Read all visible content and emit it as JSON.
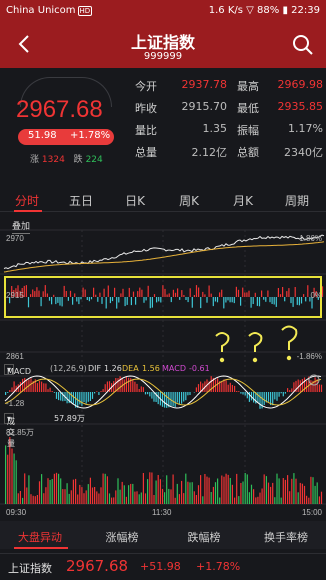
{
  "status_bar": {
    "carrier": "China Unicom",
    "sim_badge": "HD",
    "speed": "1.6 K/s",
    "battery": "88%",
    "time": "22:39"
  },
  "navbar": {
    "title": "上证指数",
    "code": "999999",
    "back_icon": "back-chevron-icon",
    "search_icon": "search-icon"
  },
  "quote": {
    "price": "2967.68",
    "change": "51.98",
    "change_pct": "+1.78%",
    "rise_label": "涨",
    "rise_count": "1324",
    "fall_label": "跌",
    "fall_count": "224"
  },
  "stats": [
    {
      "l1": "今开",
      "v1": "2937.78",
      "l2": "最高",
      "v2": "2969.98",
      "c1": "red",
      "c2": "red"
    },
    {
      "l1": "昨收",
      "v1": "2915.70",
      "l2": "最低",
      "v2": "2935.85",
      "c1": "gray",
      "c2": "red"
    },
    {
      "l1": "量比",
      "v1": "1.35",
      "l2": "振幅",
      "v2": "1.17%",
      "c1": "gray",
      "c2": "gray"
    },
    {
      "l1": "总量",
      "v1": "2.12亿",
      "l2": "总额",
      "v2": "2340亿",
      "c1": "gray",
      "c2": "gray"
    }
  ],
  "period_tabs": [
    "分时",
    "五日",
    "日K",
    "周K",
    "月K",
    "周期"
  ],
  "chart": {
    "overlay_label": "叠加",
    "price_top": "2970",
    "pct_top": "1.86%",
    "sub_left": "2915",
    "sub_right": "0%",
    "macd_axis_top": "2861",
    "macd_axis_right": "-1.86%",
    "macd_name": "MACD",
    "macd_params": "(12,26,9)",
    "dif_label": "DIF",
    "dif_value": "1.26",
    "dea_label": "DEA",
    "dea_value": "1.56",
    "macd_label": "MACD",
    "macd_value": "-0.61",
    "macd_neg_label": "-1.28",
    "vol_name": "成交量",
    "vol_value": "57.89万",
    "vol_top": "81.85万",
    "time_start": "09:30",
    "time_mid": "11:30",
    "time_end": "15:00",
    "annotation": "???"
  },
  "bottom_tabs": [
    "大盘异动",
    "涨幅榜",
    "跌幅榜",
    "换手率榜"
  ],
  "ticker": {
    "name": "上证指数",
    "price": "2967.68",
    "change": "+51.98",
    "change_pct": "+1.78%"
  },
  "colors": {
    "up": "#f03434",
    "down": "#2fbf5a",
    "header": "#9b1c1f",
    "highlight_box": "#e8e23a",
    "annotation": "#f3ea55"
  }
}
